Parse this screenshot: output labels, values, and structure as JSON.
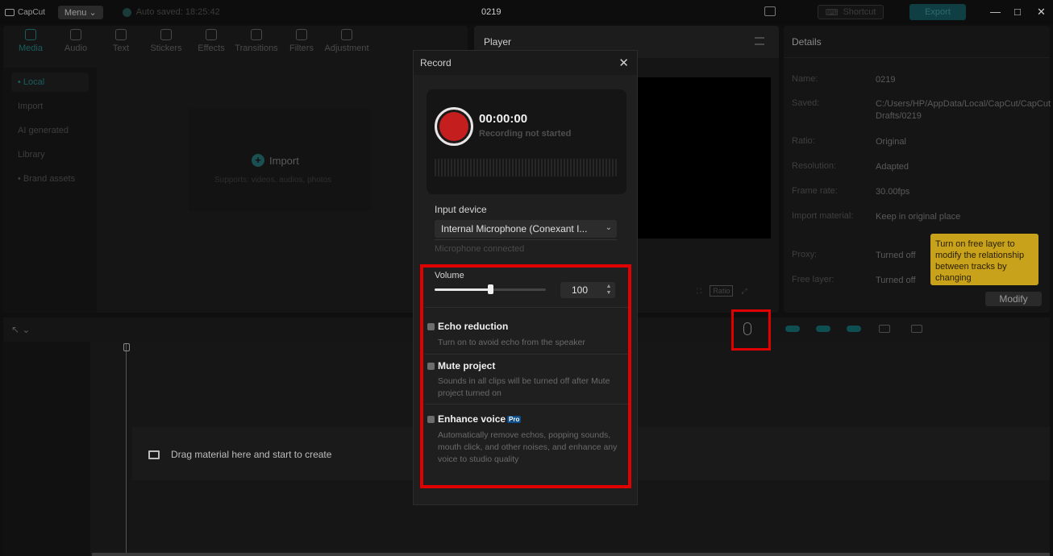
{
  "titlebar": {
    "app_name": "CapCut",
    "menu_label": "Menu",
    "autosave": "Auto saved: 18:25:42",
    "project_title": "0219",
    "shortcut_label": "Shortcut",
    "export_label": "Export",
    "minimize": "—",
    "maximize": "□",
    "close": "✕"
  },
  "media": {
    "tabs": [
      {
        "label": "Media",
        "icon": "media-icon"
      },
      {
        "label": "Audio",
        "icon": "audio-icon"
      },
      {
        "label": "Text",
        "icon": "text-icon"
      },
      {
        "label": "Stickers",
        "icon": "stickers-icon"
      },
      {
        "label": "Effects",
        "icon": "effects-icon"
      },
      {
        "label": "Transitions",
        "icon": "transitions-icon"
      },
      {
        "label": "Filters",
        "icon": "filters-icon"
      },
      {
        "label": "Adjustment",
        "icon": "adjustment-icon"
      }
    ],
    "sidebar": [
      "• Local",
      "Import",
      "AI generated",
      "Library",
      "• Brand assets"
    ],
    "import_title": "Import",
    "import_sub": "Supports: videos, audios, photos"
  },
  "player": {
    "title": "Player",
    "ratio": "Ratio"
  },
  "details": {
    "title": "Details",
    "rows": [
      {
        "label": "Name:",
        "value": "0219"
      },
      {
        "label": "Saved:",
        "value": "C:/Users/HP/AppData/Local/CapCut/CapCut Drafts/0219"
      },
      {
        "label": "Ratio:",
        "value": "Original"
      },
      {
        "label": "Resolution:",
        "value": "Adapted"
      },
      {
        "label": "Frame rate:",
        "value": "30.00fps"
      },
      {
        "label": "Import material:",
        "value": "Keep in original place"
      },
      {
        "label": "Proxy:",
        "value": "Turned off"
      },
      {
        "label": "Free layer:",
        "value": "Turned off"
      }
    ],
    "tooltip": "Turn on free layer to modify the relationship between tracks by changing",
    "modify_label": "Modify"
  },
  "timeline": {
    "drag_text": "Drag material here and start to create"
  },
  "record": {
    "title": "Record",
    "close": "✕",
    "time": "00:00:00",
    "status": "Recording not started",
    "input_device_label": "Input device",
    "input_device_value": "Internal Microphone (Conexant I...",
    "mic_status": "Microphone connected",
    "volume_label": "Volume",
    "volume_value": "100",
    "volume_level": 0.5,
    "options": [
      {
        "title": "Echo reduction",
        "desc": "Turn on to avoid echo from the speaker",
        "pro": ""
      },
      {
        "title": "Mute project",
        "desc": "Sounds in all clips will be turned off after Mute project turned on",
        "pro": ""
      },
      {
        "title": "Enhance voice",
        "desc": "Automatically remove echos, popping sounds, mouth click, and other noises, and enhance any voice to studio quality",
        "pro": "Pro"
      }
    ]
  },
  "colors": {
    "accent": "#1b5e60",
    "record_red": "#c41e1e",
    "highlight": "#e00000"
  }
}
